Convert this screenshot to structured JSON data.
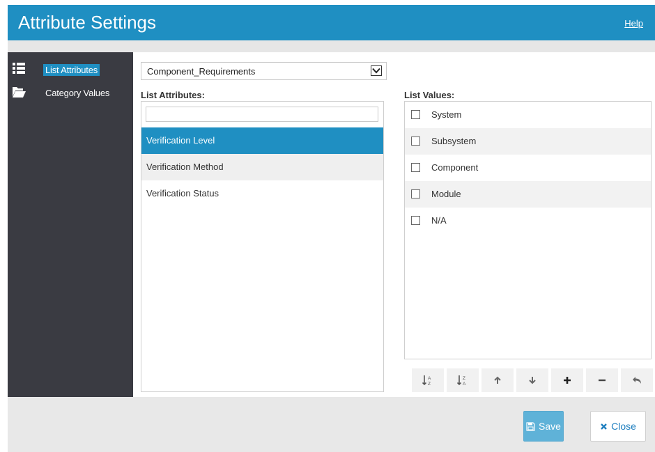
{
  "header": {
    "title": "Attribute Settings",
    "help_label": "Help"
  },
  "sidebar": {
    "items": [
      {
        "label": "List Attributes",
        "icon": "list-icon",
        "active": true
      },
      {
        "label": "Category Values",
        "icon": "folder-open-icon",
        "active": false
      }
    ]
  },
  "main": {
    "category_select": {
      "value": "Component_Requirements"
    },
    "attributes_label": "List Attributes:",
    "attribute_filter": {
      "value": "",
      "placeholder": ""
    },
    "attributes": [
      {
        "label": "Verification Level",
        "selected": true
      },
      {
        "label": "Verification Method",
        "selected": false
      },
      {
        "label": "Verification Status",
        "selected": false
      }
    ],
    "values_label": "List Values:",
    "values": [
      {
        "label": "System",
        "checked": false
      },
      {
        "label": "Subsystem",
        "checked": false
      },
      {
        "label": "Component",
        "checked": false
      },
      {
        "label": "Module",
        "checked": false
      },
      {
        "label": "N/A",
        "checked": false
      }
    ],
    "toolbar": [
      {
        "name": "sort-ascending-icon"
      },
      {
        "name": "sort-descending-icon"
      },
      {
        "name": "arrow-up-icon"
      },
      {
        "name": "arrow-down-icon"
      },
      {
        "name": "plus-icon"
      },
      {
        "name": "minus-icon"
      },
      {
        "name": "undo-icon"
      }
    ]
  },
  "footer": {
    "save_label": "Save",
    "close_label": "Close"
  },
  "colors": {
    "accent": "#1f8fc2",
    "sidebar": "#3a3b42",
    "save_button": "#5fb2d8"
  }
}
